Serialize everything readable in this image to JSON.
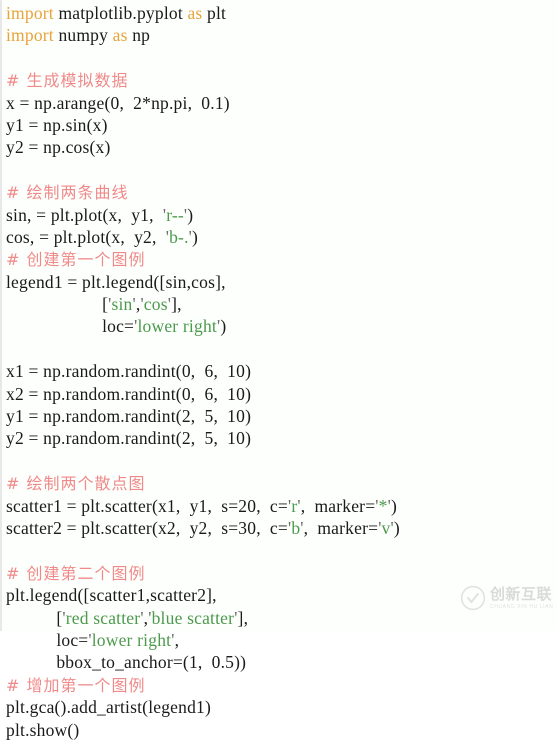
{
  "document": {
    "kind": "python-source-code-snippet",
    "language": "Python",
    "colors": {
      "background": "#fdfffc",
      "page_background": "#ffffff",
      "keyword": "#e8a33d",
      "comment": "#f08a8a",
      "string": "#4c9a4c",
      "quote": "#6b6b6b",
      "plain_text": "#1a1a1a",
      "left_border": "#e8e8e8",
      "watermark": "#b8b8b8"
    }
  },
  "code": {
    "lines": [
      {
        "id": "line-1",
        "tokens": [
          {
            "t": "import",
            "c": "kw"
          },
          {
            "t": " matplotlib.pyplot ",
            "c": "plain"
          },
          {
            "t": "as",
            "c": "kw"
          },
          {
            "t": " plt",
            "c": "plain"
          }
        ]
      },
      {
        "id": "line-2",
        "tokens": [
          {
            "t": "import",
            "c": "kw"
          },
          {
            "t": " numpy ",
            "c": "plain"
          },
          {
            "t": "as",
            "c": "kw"
          },
          {
            "t": " np",
            "c": "plain"
          }
        ]
      },
      {
        "id": "line-3",
        "blank": true,
        "tokens": []
      },
      {
        "id": "line-4",
        "tokens": [
          {
            "t": "# 生成模拟数据",
            "c": "comment",
            "cjk": true
          }
        ]
      },
      {
        "id": "line-5",
        "tokens": [
          {
            "t": "x = np.arange(0,  2*np.pi,  0.1)",
            "c": "plain"
          }
        ]
      },
      {
        "id": "line-6",
        "tokens": [
          {
            "t": "y1 = np.sin(x)",
            "c": "plain"
          }
        ]
      },
      {
        "id": "line-7",
        "tokens": [
          {
            "t": "y2 = np.cos(x)",
            "c": "plain"
          }
        ]
      },
      {
        "id": "line-8",
        "blank": true,
        "tokens": []
      },
      {
        "id": "line-9",
        "tokens": [
          {
            "t": "# 绘制两条曲线",
            "c": "comment",
            "cjk": true
          }
        ]
      },
      {
        "id": "line-10",
        "tokens": [
          {
            "t": "sin, = plt.plot(x,  y1,  ",
            "c": "plain"
          },
          {
            "t": "'",
            "c": "quote"
          },
          {
            "t": "r--",
            "c": "str"
          },
          {
            "t": "'",
            "c": "quote"
          },
          {
            "t": ")",
            "c": "plain"
          }
        ]
      },
      {
        "id": "line-11",
        "tokens": [
          {
            "t": "cos, = plt.plot(x,  y2,  ",
            "c": "plain"
          },
          {
            "t": "'",
            "c": "quote"
          },
          {
            "t": "b-.",
            "c": "str"
          },
          {
            "t": "'",
            "c": "quote"
          },
          {
            "t": ")",
            "c": "plain"
          }
        ]
      },
      {
        "id": "line-12",
        "tokens": [
          {
            "t": "# 创建第一个图例",
            "c": "comment",
            "cjk": true
          }
        ]
      },
      {
        "id": "line-13",
        "tokens": [
          {
            "t": "legend1 = plt.legend([sin,cos],",
            "c": "plain"
          }
        ]
      },
      {
        "id": "line-14",
        "tokens": [
          {
            "t": "                     [",
            "c": "plain"
          },
          {
            "t": "'",
            "c": "quote"
          },
          {
            "t": "sin",
            "c": "str"
          },
          {
            "t": "'",
            "c": "quote"
          },
          {
            "t": ",",
            "c": "plain"
          },
          {
            "t": "'",
            "c": "quote"
          },
          {
            "t": "cos",
            "c": "str"
          },
          {
            "t": "'",
            "c": "quote"
          },
          {
            "t": "],",
            "c": "plain"
          }
        ]
      },
      {
        "id": "line-15",
        "tokens": [
          {
            "t": "                     loc=",
            "c": "plain"
          },
          {
            "t": "'",
            "c": "quote"
          },
          {
            "t": "lower right",
            "c": "str"
          },
          {
            "t": "'",
            "c": "quote"
          },
          {
            "t": ")",
            "c": "plain"
          }
        ]
      },
      {
        "id": "line-16",
        "blank": true,
        "tokens": []
      },
      {
        "id": "line-17",
        "tokens": [
          {
            "t": "x1 = np.random.randint(0,  6,  10)",
            "c": "plain"
          }
        ]
      },
      {
        "id": "line-18",
        "tokens": [
          {
            "t": "x2 = np.random.randint(0,  6,  10)",
            "c": "plain"
          }
        ]
      },
      {
        "id": "line-19",
        "tokens": [
          {
            "t": "y1 = np.random.randint(2,  5,  10)",
            "c": "plain"
          }
        ]
      },
      {
        "id": "line-20",
        "tokens": [
          {
            "t": "y2 = np.random.randint(2,  5,  10)",
            "c": "plain"
          }
        ]
      },
      {
        "id": "line-21",
        "blank": true,
        "tokens": []
      },
      {
        "id": "line-22",
        "tokens": [
          {
            "t": "# 绘制两个散点图",
            "c": "comment",
            "cjk": true
          }
        ]
      },
      {
        "id": "line-23",
        "tokens": [
          {
            "t": "scatter1 = plt.scatter(x1,  y1,  s=20,  c=",
            "c": "plain"
          },
          {
            "t": "'",
            "c": "quote"
          },
          {
            "t": "r",
            "c": "str"
          },
          {
            "t": "'",
            "c": "quote"
          },
          {
            "t": ",  marker=",
            "c": "plain"
          },
          {
            "t": "'",
            "c": "quote"
          },
          {
            "t": "*",
            "c": "str"
          },
          {
            "t": "'",
            "c": "quote"
          },
          {
            "t": ")",
            "c": "plain"
          }
        ]
      },
      {
        "id": "line-24",
        "tokens": [
          {
            "t": "scatter2 = plt.scatter(x2,  y2,  s=30,  c=",
            "c": "plain"
          },
          {
            "t": "'",
            "c": "quote"
          },
          {
            "t": "b",
            "c": "str"
          },
          {
            "t": "'",
            "c": "quote"
          },
          {
            "t": ",  marker=",
            "c": "plain"
          },
          {
            "t": "'",
            "c": "quote"
          },
          {
            "t": "v",
            "c": "str"
          },
          {
            "t": "'",
            "c": "quote"
          },
          {
            "t": ")",
            "c": "plain"
          }
        ]
      },
      {
        "id": "line-25",
        "blank": true,
        "tokens": []
      },
      {
        "id": "line-26",
        "tokens": [
          {
            "t": "# 创建第二个图例",
            "c": "comment",
            "cjk": true
          }
        ]
      },
      {
        "id": "line-27",
        "tokens": [
          {
            "t": "plt.legend([scatter1,scatter2],",
            "c": "plain"
          }
        ]
      },
      {
        "id": "line-28",
        "tokens": [
          {
            "t": "           [",
            "c": "plain"
          },
          {
            "t": "'",
            "c": "quote"
          },
          {
            "t": "red scatter",
            "c": "str"
          },
          {
            "t": "'",
            "c": "quote"
          },
          {
            "t": ",",
            "c": "plain"
          },
          {
            "t": "'",
            "c": "quote"
          },
          {
            "t": "blue scatter",
            "c": "str"
          },
          {
            "t": "'",
            "c": "quote"
          },
          {
            "t": "],",
            "c": "plain"
          }
        ]
      },
      {
        "id": "line-29",
        "tokens": [
          {
            "t": "           loc=",
            "c": "plain"
          },
          {
            "t": "'",
            "c": "quote"
          },
          {
            "t": "lower right",
            "c": "str"
          },
          {
            "t": "'",
            "c": "quote"
          },
          {
            "t": ",",
            "c": "plain"
          }
        ]
      },
      {
        "id": "line-30",
        "tokens": [
          {
            "t": "           bbox_to_anchor=(1,  0.5))",
            "c": "plain"
          }
        ]
      },
      {
        "id": "line-31",
        "tokens": [
          {
            "t": "# 增加第一个图例",
            "c": "comment",
            "cjk": true
          }
        ]
      },
      {
        "id": "line-32",
        "tokens": [
          {
            "t": "plt.gca().add_artist(legend1)",
            "c": "plain"
          }
        ]
      },
      {
        "id": "line-33",
        "tokens": [
          {
            "t": "plt.show()",
            "c": "plain"
          }
        ]
      }
    ]
  },
  "watermark": {
    "chinese": "创新互联",
    "pinyin": "CHUANG XIN HU LIAN"
  }
}
